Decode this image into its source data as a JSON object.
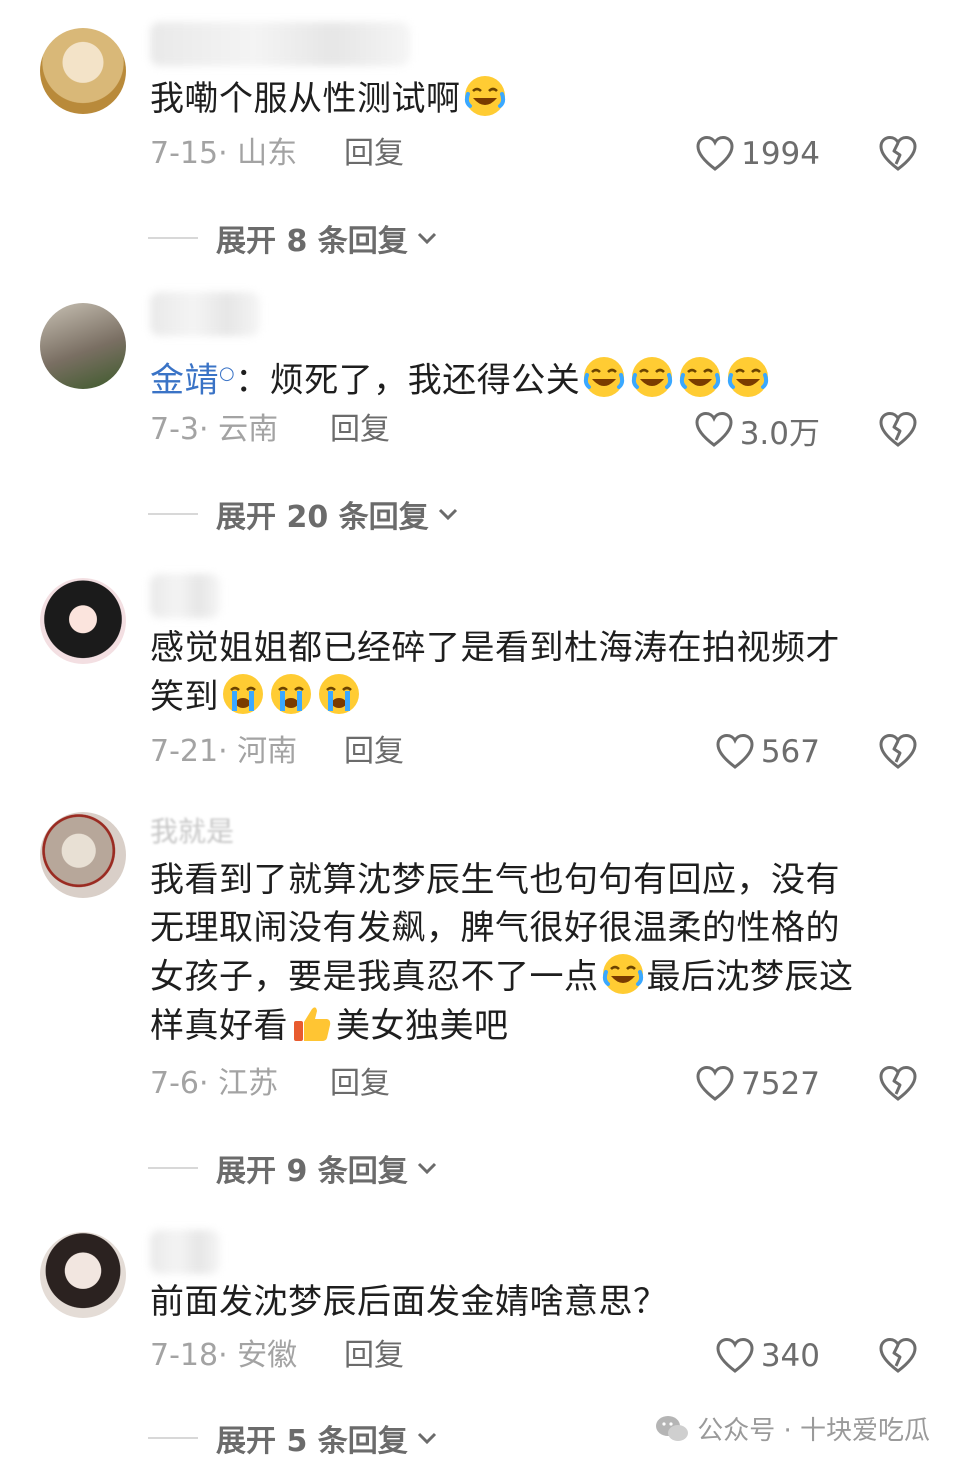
{
  "comments": [
    {
      "text_before": "我嘞个服从性测试啊",
      "emojis": [
        "laughing-crying"
      ],
      "date": "7-15",
      "location": "山东",
      "reply_label": "回复",
      "likes": "1994",
      "expand_label": "展开 8 条回复"
    },
    {
      "mention": "金靖",
      "text_after": "：烦死了，我还得公关",
      "emojis": [
        "laughing-crying",
        "laughing-crying",
        "laughing-crying",
        "laughing-crying"
      ],
      "date": "7-3",
      "location": "云南",
      "reply_label": "回复",
      "likes": "3.0万",
      "expand_label": "展开 20 条回复"
    },
    {
      "text_line1": "感觉姐姐都已经碎了是看到杜海涛在拍视频才",
      "text_line2": "笑到",
      "emojis": [
        "crying",
        "crying",
        "crying"
      ],
      "date": "7-21",
      "location": "河南",
      "reply_label": "回复",
      "likes": "567"
    },
    {
      "username": "我就是",
      "text_line1": "我看到了就算沈梦辰生气也句句有回应，没有",
      "text_line2": "无理取闹没有发飙，脾气很好很温柔的性格的",
      "text_line3a": "女孩子，要是我真忍不了一点",
      "text_line3b": "最后沈梦辰这",
      "text_line4a": "样真好看",
      "text_line4b": "美女独美吧",
      "date": "7-6",
      "location": "江苏",
      "reply_label": "回复",
      "likes": "7527",
      "expand_label": "展开 9 条回复"
    },
    {
      "text": "前面发沈梦辰后面发金婧啥意思？",
      "date": "7-18",
      "location": "安徽",
      "reply_label": "回复",
      "likes": "340",
      "expand_label": "展开 5 条回复"
    }
  ],
  "watermark": "公众号 · 十块爱吃瓜",
  "colors": {
    "mention": "#3a73c6",
    "meta": "#a3a3a3",
    "text": "#1e1e1e"
  }
}
